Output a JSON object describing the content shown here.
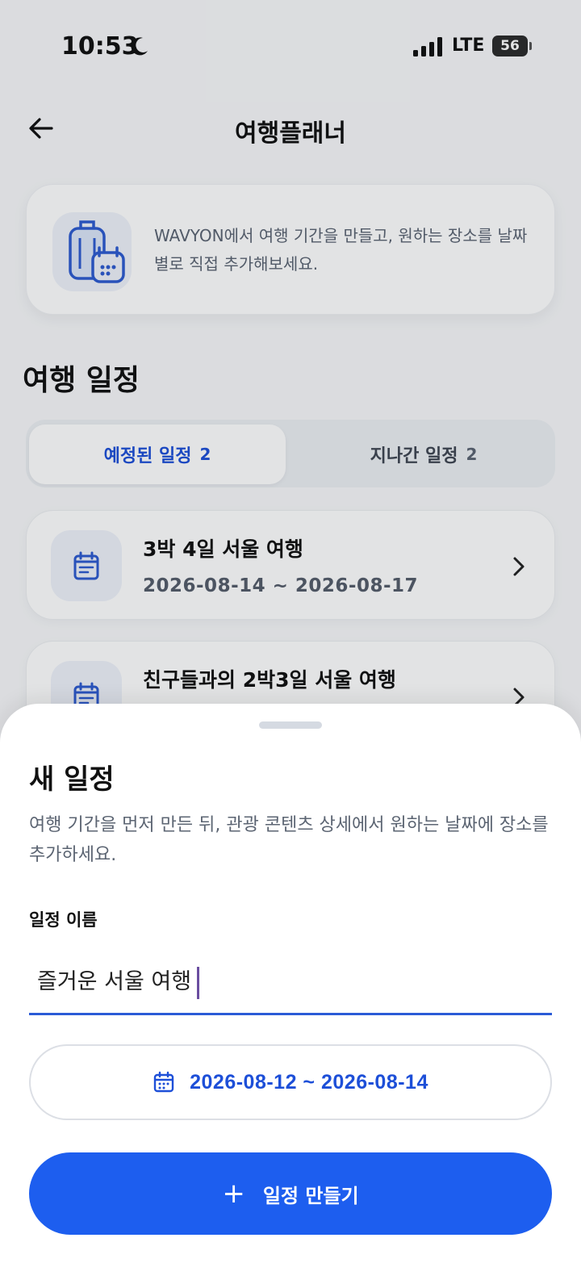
{
  "status_bar": {
    "time": "10:53",
    "network": "LTE",
    "battery": "56"
  },
  "header": {
    "title": "여행플래너"
  },
  "info_card": {
    "text": "WAVYON에서 여행 기간을 만들고, 원하는 장소를 날짜별로 직접 추가해보세요."
  },
  "section": {
    "title": "여행 일정"
  },
  "tabs": [
    {
      "label": "예정된 일정",
      "count": "2",
      "active": true
    },
    {
      "label": "지나간 일정",
      "count": "2",
      "active": false
    }
  ],
  "trips": [
    {
      "title": "3박 4일 서울 여행",
      "dates": "2026-08-14 ~ 2026-08-17"
    },
    {
      "title": "친구들과의 2박3일 서울 여행",
      "dates": ""
    }
  ],
  "sheet": {
    "title": "새 일정",
    "description": "여행 기간을 먼저 만든 뒤, 관광 콘텐츠 상세에서 원하는 날짜에 장소를 추가하세요.",
    "name_label": "일정 이름",
    "name_value": "즐거운 서울 여행",
    "date_range": "2026-08-12 ~ 2026-08-14",
    "create_label": "일정 만들기"
  },
  "colors": {
    "accent": "#1d5eef",
    "accent_text": "#1d4fd8"
  }
}
